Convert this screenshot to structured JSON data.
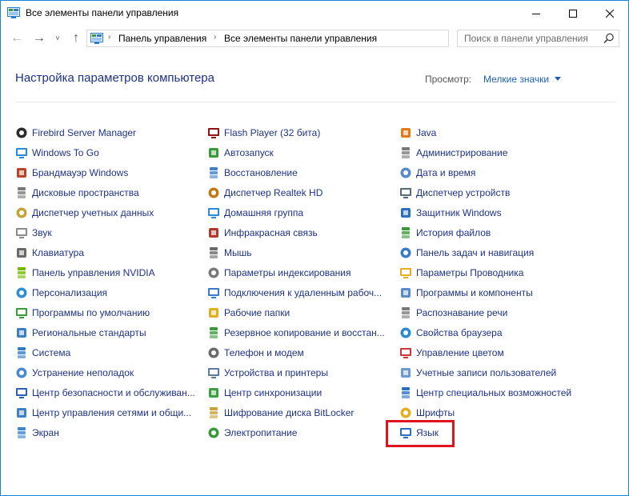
{
  "window": {
    "title": "Все элементы панели управления"
  },
  "nav": {
    "back_label": "←",
    "forward_label": "→",
    "history_label": "˅",
    "up_label": "↑"
  },
  "address": {
    "crumbs": [
      "Панель управления",
      "Все элементы панели управления"
    ],
    "separator": "›",
    "dropdown": "˅",
    "refresh": "↻"
  },
  "search": {
    "placeholder": "Поиск в панели управления"
  },
  "header": {
    "title": "Настройка параметров компьютера",
    "view_label": "Просмотр:",
    "view_value": "Мелкие значки"
  },
  "columns": [
    [
      {
        "label": "Firebird Server Manager",
        "icon": "firebird-icon",
        "color": "#2b2b2b"
      },
      {
        "label": "Windows To Go",
        "icon": "windows-to-go-icon",
        "color": "#2a8ad6"
      },
      {
        "label": "Брандмауэр Windows",
        "icon": "firewall-icon",
        "color": "#b5452b"
      },
      {
        "label": "Дисковые пространства",
        "icon": "storage-spaces-icon",
        "color": "#7a7a7a"
      },
      {
        "label": "Диспетчер учетных данных",
        "icon": "credential-manager-icon",
        "color": "#c8a23a"
      },
      {
        "label": "Звук",
        "icon": "sound-icon",
        "color": "#8a8a8a"
      },
      {
        "label": "Клавиатура",
        "icon": "keyboard-icon",
        "color": "#6a6a6a"
      },
      {
        "label": "Панель управления NVIDIA",
        "icon": "nvidia-icon",
        "color": "#76b900"
      },
      {
        "label": "Персонализация",
        "icon": "personalization-icon",
        "color": "#2f8fd1"
      },
      {
        "label": "Программы по умолчанию",
        "icon": "default-programs-icon",
        "color": "#3a9a3a"
      },
      {
        "label": "Региональные стандарты",
        "icon": "region-icon",
        "color": "#3c7fc9"
      },
      {
        "label": "Система",
        "icon": "system-icon",
        "color": "#2e7dc4"
      },
      {
        "label": "Устранение неполадок",
        "icon": "troubleshooting-icon",
        "color": "#4a8ad0"
      },
      {
        "label": "Центр безопасности и обслуживан...",
        "icon": "security-maintenance-icon",
        "color": "#2a5fb3"
      },
      {
        "label": "Центр управления сетями и общи...",
        "icon": "network-center-icon",
        "color": "#3f7fc6"
      },
      {
        "label": "Экран",
        "icon": "display-icon",
        "color": "#3a86cf"
      }
    ],
    [
      {
        "label": "Flash Player (32 бита)",
        "icon": "flash-player-icon",
        "color": "#8b1515"
      },
      {
        "label": "Автозапуск",
        "icon": "autoplay-icon",
        "color": "#3a9a3a"
      },
      {
        "label": "Восстановление",
        "icon": "recovery-icon",
        "color": "#3f7fc6"
      },
      {
        "label": "Диспетчер Realtek HD",
        "icon": "realtek-icon",
        "color": "#c07a1a"
      },
      {
        "label": "Домашняя группа",
        "icon": "homegroup-icon",
        "color": "#2a8ad6"
      },
      {
        "label": "Инфракрасная связь",
        "icon": "infrared-icon",
        "color": "#b03a2a"
      },
      {
        "label": "Мышь",
        "icon": "mouse-icon",
        "color": "#6a6a6a"
      },
      {
        "label": "Параметры индексирования",
        "icon": "indexing-icon",
        "color": "#7a7a7a"
      },
      {
        "label": "Подключения к удаленным рабоч...",
        "icon": "remote-desktop-icon",
        "color": "#3a7ac9"
      },
      {
        "label": "Рабочие папки",
        "icon": "work-folders-icon",
        "color": "#e0b020"
      },
      {
        "label": "Резервное копирование и восстан...",
        "icon": "backup-icon",
        "color": "#3a9a3a"
      },
      {
        "label": "Телефон и модем",
        "icon": "phone-modem-icon",
        "color": "#6a6a6a"
      },
      {
        "label": "Устройства и принтеры",
        "icon": "devices-printers-icon",
        "color": "#5a7a9a"
      },
      {
        "label": "Центр синхронизации",
        "icon": "sync-center-icon",
        "color": "#3aa040"
      },
      {
        "label": "Шифрование диска BitLocker",
        "icon": "bitlocker-icon",
        "color": "#c8a23a"
      },
      {
        "label": "Электропитание",
        "icon": "power-options-icon",
        "color": "#3a9a3a"
      }
    ],
    [
      {
        "label": "Java",
        "icon": "java-icon",
        "color": "#e07a1a"
      },
      {
        "label": "Администрирование",
        "icon": "admin-tools-icon",
        "color": "#7a7a7a"
      },
      {
        "label": "Дата и время",
        "icon": "date-time-icon",
        "color": "#5a8ac9"
      },
      {
        "label": "Диспетчер устройств",
        "icon": "device-manager-icon",
        "color": "#5a6a7a"
      },
      {
        "label": "Защитник Windows",
        "icon": "defender-icon",
        "color": "#2a6fc0"
      },
      {
        "label": "История файлов",
        "icon": "file-history-icon",
        "color": "#3a9a3a"
      },
      {
        "label": "Панель задач и навигация",
        "icon": "taskbar-icon",
        "color": "#3a7ac9"
      },
      {
        "label": "Параметры Проводника",
        "icon": "explorer-options-icon",
        "color": "#e0b020"
      },
      {
        "label": "Программы и компоненты",
        "icon": "programs-features-icon",
        "color": "#5a8ac9"
      },
      {
        "label": "Распознавание речи",
        "icon": "speech-icon",
        "color": "#7a7a7a"
      },
      {
        "label": "Свойства браузера",
        "icon": "internet-options-icon",
        "color": "#2a8ad6"
      },
      {
        "label": "Управление цветом",
        "icon": "color-management-icon",
        "color": "#c83a3a"
      },
      {
        "label": "Учетные записи пользователей",
        "icon": "user-accounts-icon",
        "color": "#6a9ad0"
      },
      {
        "label": "Центр специальных возможностей",
        "icon": "ease-of-access-icon",
        "color": "#2a6fc0"
      },
      {
        "label": "Шрифты",
        "icon": "fonts-icon",
        "color": "#e0b020"
      },
      {
        "label": "Язык",
        "icon": "language-icon",
        "color": "#2a6fc0"
      }
    ]
  ],
  "highlight": {
    "color": "#e0141f"
  }
}
